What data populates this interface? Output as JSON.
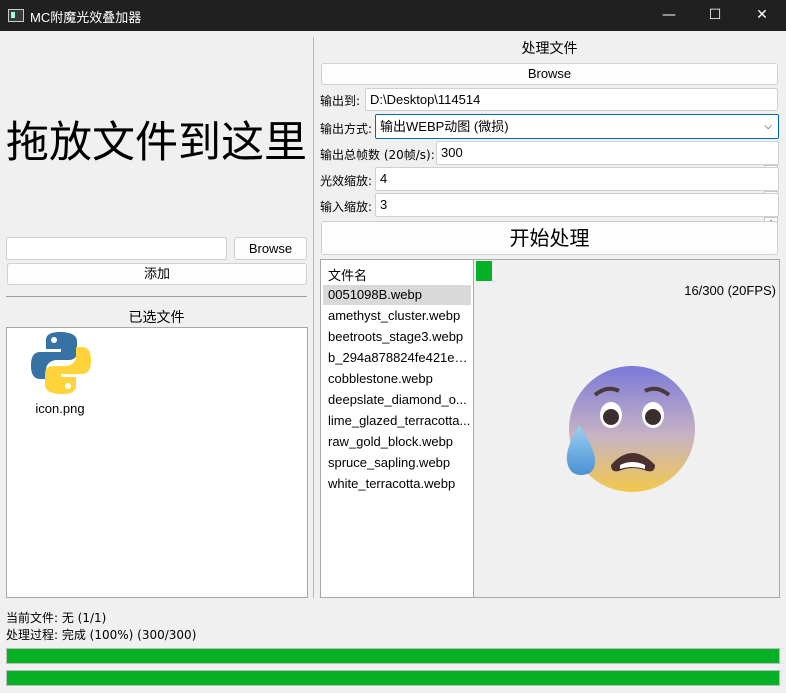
{
  "window": {
    "title": "MC附魔光效叠加器",
    "minimize": "—",
    "maximize": "☐",
    "close": "✕"
  },
  "left": {
    "drop_hint": "拖放文件到这里",
    "path_value": "",
    "browse_label": "Browse",
    "add_label": "添加",
    "selected_title": "已选文件",
    "files": [
      {
        "name": "icon.png",
        "icon": "python-icon"
      }
    ]
  },
  "right": {
    "title": "处理文件",
    "browse_label": "Browse",
    "output_to_label": "输出到:",
    "output_to_value": "D:\\Desktop\\114514",
    "output_mode_label": "输出方式:",
    "output_mode_value": "输出WEBP动图 (微损)",
    "total_frames_label": "输出总帧数 (20帧/s):",
    "total_frames_value": "300",
    "glint_scale_label": "光效缩放:",
    "glint_scale_value": "4",
    "input_scale_label": "输入缩放:",
    "input_scale_value": "3",
    "start_label": "开始处理",
    "list_header": "文件名",
    "list_items": [
      "0051098B.webp",
      "amethyst_cluster.webp",
      "beetroots_stage3.webp",
      "b_294a878824fe421ee...",
      "cobblestone.webp",
      "deepslate_diamond_o...",
      "lime_glazed_terracotta...",
      "raw_gold_block.webp",
      "spruce_sapling.webp",
      "white_terracotta.webp"
    ],
    "selected_index": 0,
    "preview_counter": "16/300 (20FPS)",
    "preview_image": "anxious-face-sweat-emoji"
  },
  "status": {
    "current_file": "当前文件: 无 (1/1)",
    "progress_text": "处理过程: 完成 (100%) (300/300)",
    "bar1_fraction": 1.0,
    "bar2_fraction": 1.0,
    "bar_color": "#06b025"
  }
}
